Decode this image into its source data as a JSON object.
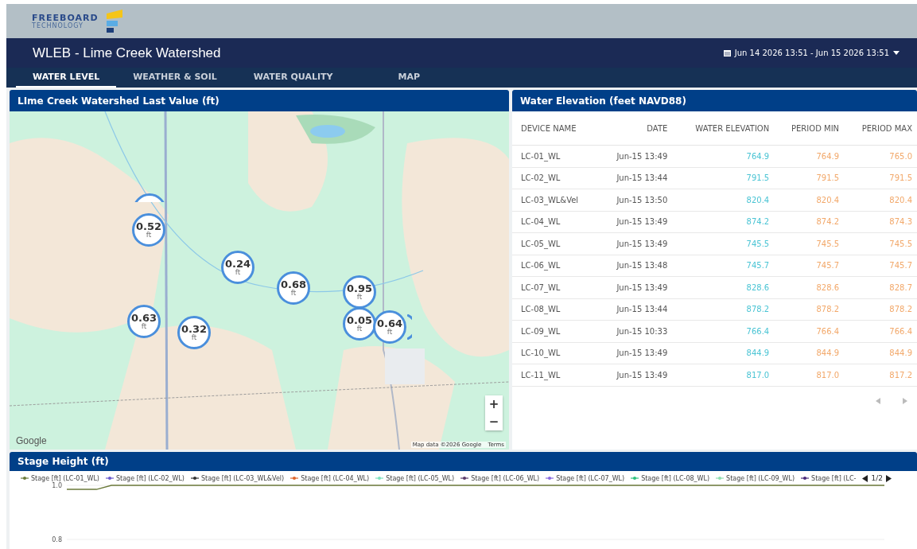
{
  "brand": {
    "name": "FREEBOARD",
    "tagline": "TECHNOLOGY"
  },
  "title": "WLEB - Lime Creek Watershed",
  "date_range": "Jun 14 2026 13:51 - Jun 15 2026 13:51",
  "tabs": [
    {
      "label": "WATER LEVEL",
      "selected": true
    },
    {
      "label": "WEATHER & SOIL",
      "selected": false
    },
    {
      "label": "WATER QUALITY",
      "selected": false
    },
    {
      "label": "MAP",
      "selected": false
    }
  ],
  "map_panel": {
    "title": "LIme Creek Watershed Last Value (ft)",
    "markers": [
      {
        "kind": "covered"
      },
      {
        "kind": "reading",
        "value": "0.52",
        "unit": "ft"
      },
      {
        "kind": "reading",
        "value": "0.24",
        "unit": "ft"
      },
      {
        "kind": "reading",
        "value": "0.68",
        "unit": "ft"
      },
      {
        "kind": "reading",
        "value": "0.95",
        "unit": "ft"
      },
      {
        "kind": "reading",
        "value": "0.63",
        "unit": "ft"
      },
      {
        "kind": "reading",
        "value": "0.32",
        "unit": "ft"
      },
      {
        "kind": "reading",
        "value": "0.05",
        "unit": "ft"
      },
      {
        "kind": "stacked",
        "value": "0.64",
        "unit": "ft"
      }
    ],
    "zoom_in": "+",
    "zoom_out": "−",
    "logo_text": "Google",
    "attribution": "Map data ©2026 Google",
    "terms": "Terms"
  },
  "table_panel": {
    "title": "Water Elevation (feet NAVD88)",
    "columns": [
      "DEVICE NAME",
      "DATE",
      "WATER ELEVATION",
      "PERIOD MIN",
      "PERIOD MAX"
    ],
    "rows": [
      [
        "LC-01_WL",
        "Jun-15 13:49",
        "764.9",
        "764.9",
        "765.0"
      ],
      [
        "LC-02_WL",
        "Jun-15 13:44",
        "791.5",
        "791.5",
        "791.5"
      ],
      [
        "LC-03_WL&Vel",
        "Jun-15 13:50",
        "820.4",
        "820.4",
        "820.4"
      ],
      [
        "LC-04_WL",
        "Jun-15 13:49",
        "874.2",
        "874.2",
        "874.3"
      ],
      [
        "LC-05_WL",
        "Jun-15 13:49",
        "745.5",
        "745.5",
        "745.5"
      ],
      [
        "LC-06_WL",
        "Jun-15 13:48",
        "745.7",
        "745.7",
        "745.7"
      ],
      [
        "LC-07_WL",
        "Jun-15 13:49",
        "828.6",
        "828.6",
        "828.7"
      ],
      [
        "LC-08_WL",
        "Jun-15 13:44",
        "878.2",
        "878.2",
        "878.2"
      ],
      [
        "LC-09_WL",
        "Jun-15 10:33",
        "766.4",
        "766.4",
        "766.4"
      ],
      [
        "LC-10_WL",
        "Jun-15 13:49",
        "844.9",
        "844.9",
        "844.9"
      ],
      [
        "LC-11_WL",
        "Jun-15 13:49",
        "817.0",
        "817.0",
        "817.2"
      ]
    ]
  },
  "stage_panel": {
    "title": "Stage Height (ft)",
    "legend": [
      {
        "label": "Stage [ft] (LC-01_WL)",
        "color": "#6b7a3a"
      },
      {
        "label": "Stage [ft] (LC-02_WL)",
        "color": "#6a5acd"
      },
      {
        "label": "Stage [ft] (LC-03_WL&Vel)",
        "color": "#333333"
      },
      {
        "label": "Stage [ft] (LC-04_WL)",
        "color": "#e0662b"
      },
      {
        "label": "Stage [ft] (LC-05_WL)",
        "color": "#7fe3c0"
      },
      {
        "label": "Stage [ft] (LC-06_WL)",
        "color": "#5a3a6a"
      },
      {
        "label": "Stage [ft] (LC-07_WL)",
        "color": "#8a6ae0"
      },
      {
        "label": "Stage [ft] (LC-08_WL)",
        "color": "#2ec27e"
      },
      {
        "label": "Stage [ft] (LC-09_WL)",
        "color": "#90e0b0"
      },
      {
        "label": "Stage [ft] (LC-",
        "color": "#4a2a7a"
      }
    ],
    "pager": "1/2",
    "chart_data": {
      "type": "line",
      "yticks": [
        {
          "value": 1.0,
          "label": "1.0"
        },
        {
          "value": 0.8,
          "label": "0.8"
        }
      ],
      "ylim": [
        0.8,
        1.0
      ],
      "series": [
        {
          "color": "#6b7a3a",
          "values": [
            0.985,
            0.985,
            0.985,
            1.0,
            1.0,
            1.0,
            1.0,
            1.0,
            1.0,
            1.0,
            1.0,
            1.0,
            1.0,
            1.0,
            1.0,
            1.0,
            1.0,
            1.0,
            1.0,
            1.0,
            1.0,
            1.0,
            1.0,
            1.0,
            1.0,
            1.0,
            1.0,
            1.0,
            1.0,
            1.0,
            1.0,
            1.0,
            1.0,
            1.0,
            1.0,
            1.0,
            1.0,
            1.0,
            1.0,
            1.0,
            1.0,
            1.0,
            1.0,
            1.0,
            1.0,
            1.0,
            1.0,
            1.0,
            1.0,
            1.0,
            1.0,
            1.0,
            1.0,
            1.0,
            1.0,
            1.0
          ]
        }
      ]
    }
  }
}
